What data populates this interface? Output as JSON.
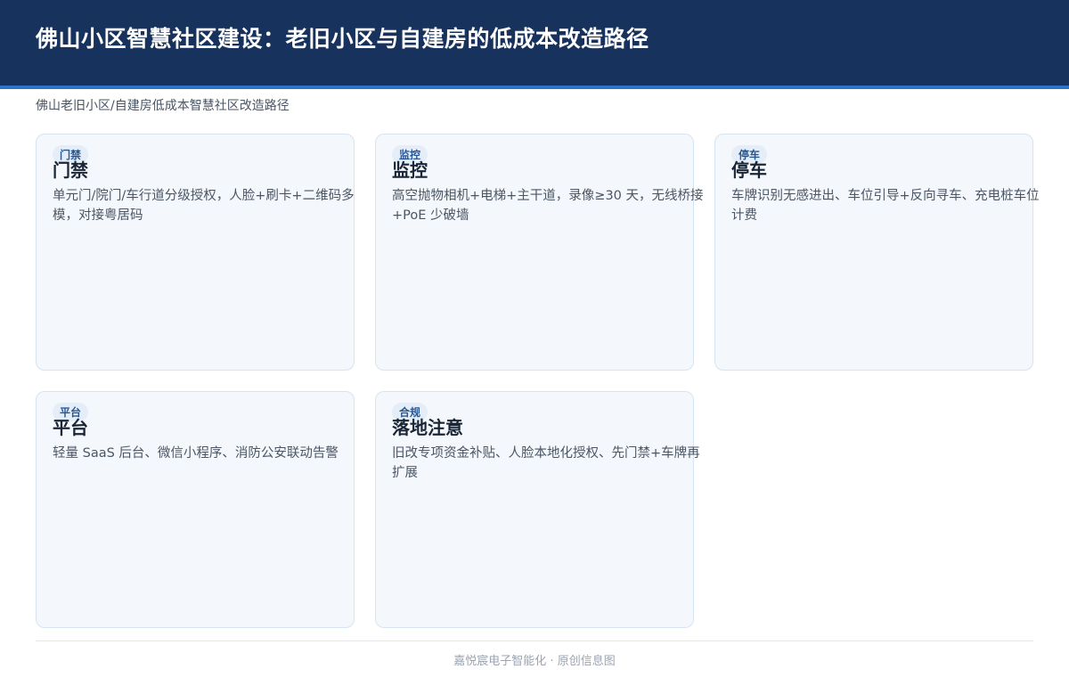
{
  "header": {
    "title": "佛山小区智慧社区建设：老旧小区与自建房的低成本改造路径"
  },
  "subtitle": "佛山老旧小区/自建房低成本智慧社区改造路径",
  "cards": [
    {
      "badge": "门禁",
      "title": "门禁",
      "desc": "单元门/院门/车行道分级授权，人脸+刷卡+二维码多模，对接粤居码"
    },
    {
      "badge": "监控",
      "title": "监控",
      "desc": "高空抛物相机+电梯+主干道，录像≥30 天，无线桥接+PoE 少破墙"
    },
    {
      "badge": "停车",
      "title": "停车",
      "desc": "车牌识别无感进出、车位引导+反向寻车、充电桩车位计费"
    },
    {
      "badge": "平台",
      "title": "平台",
      "desc": "轻量 SaaS 后台、微信小程序、消防公安联动告警"
    },
    {
      "badge": "合规",
      "title": "落地注意",
      "desc": "旧改专项资金补贴、人脸本地化授权、先门禁+车牌再扩展"
    }
  ],
  "footer": "嘉悦宸电子智能化 · 原创信息图",
  "colors": {
    "header_bg": "#17325c",
    "header_accent": "#2d73c8",
    "card_bg": "#f4f8fc",
    "card_border": "#d6e3f2",
    "badge_text": "#1c4f8f"
  }
}
